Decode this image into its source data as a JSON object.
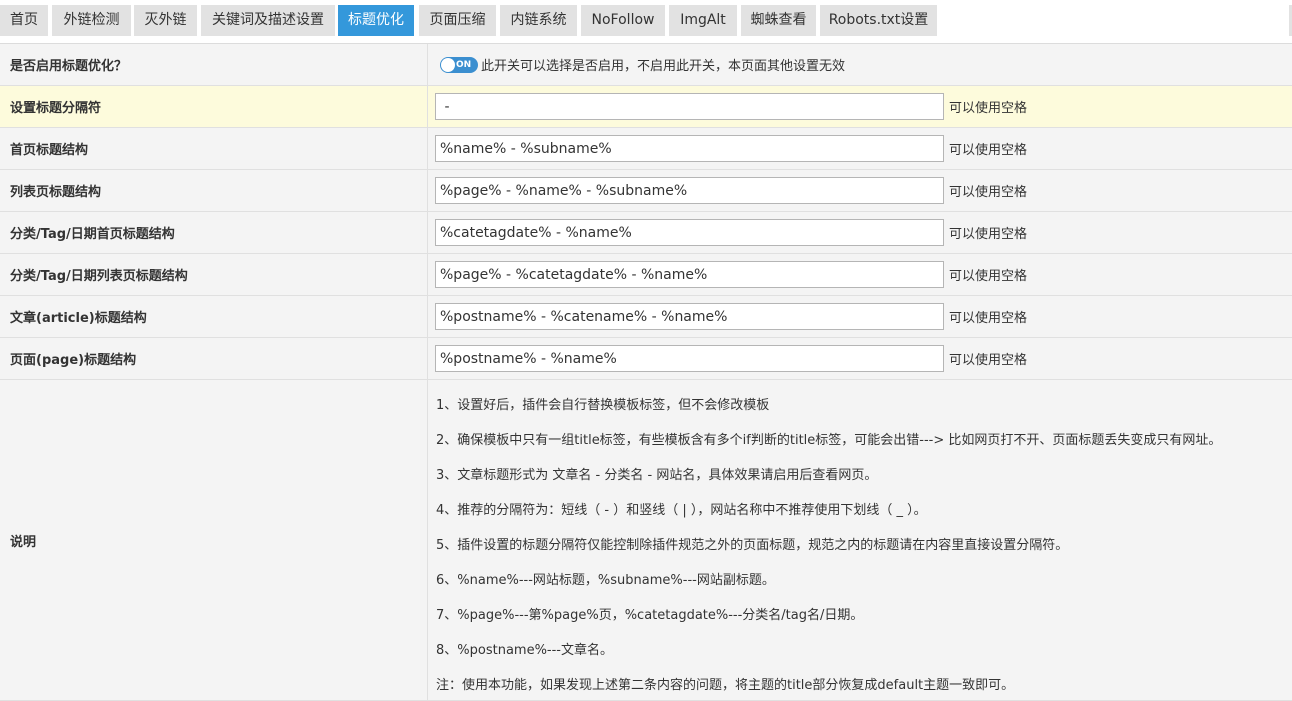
{
  "tabs": [
    {
      "label": "首页"
    },
    {
      "label": "外链检测"
    },
    {
      "label": "灭外链"
    },
    {
      "label": "关键词及描述设置"
    },
    {
      "label": "标题优化"
    },
    {
      "label": "页面压缩"
    },
    {
      "label": "内链系统"
    },
    {
      "label": "NoFollow"
    },
    {
      "label": "ImgAlt"
    },
    {
      "label": "蜘蛛查看"
    },
    {
      "label": "Robots.txt设置"
    }
  ],
  "active_tab": "标题优化",
  "enable_row": {
    "label": "是否启用标题优化？",
    "toggle_state": "ON",
    "description": "此开关可以选择是否启用，不启用此开关，本页面其他设置无效"
  },
  "fields": [
    {
      "label": "设置标题分隔符",
      "value": " - ",
      "hint": "可以使用空格"
    },
    {
      "label": "首页标题结构",
      "value": "%name% - %subname%",
      "hint": "可以使用空格"
    },
    {
      "label": "列表页标题结构",
      "value": "%page% - %name% - %subname%",
      "hint": "可以使用空格"
    },
    {
      "label": "分类/Tag/日期首页标题结构",
      "value": "%catetagdate% - %name%",
      "hint": "可以使用空格"
    },
    {
      "label": "分类/Tag/日期列表页标题结构",
      "value": "%page% - %catetagdate% - %name%",
      "hint": "可以使用空格"
    },
    {
      "label": "文章(article)标题结构",
      "value": "%postname% - %catename% - %name%",
      "hint": "可以使用空格"
    },
    {
      "label": "页面(page)标题结构",
      "value": "%postname% - %name%",
      "hint": "可以使用空格"
    }
  ],
  "notes": {
    "label": "说明",
    "lines": [
      "1、设置好后，插件会自行替换模板标签，但不会修改模板",
      "2、确保模板中只有一组title标签，有些模板含有多个if判断的title标签，可能会出错---> 比如网页打不开、页面标题丢失变成只有网址。",
      "3、文章标题形式为 文章名 - 分类名 - 网站名，具体效果请启用后查看网页。",
      "4、推荐的分隔符为：短线（ - ）和竖线（ | ），网站名称中不推荐使用下划线（ _ ）。",
      "5、插件设置的标题分隔符仅能控制除插件规范之外的页面标题，规范之内的标题请在内容里直接设置分隔符。",
      "6、%name%---网站标题，%subname%---网站副标题。",
      "7、%page%---第%page%页，%catetagdate%---分类名/tag名/日期。",
      "8、%postname%---文章名。",
      "注：使用本功能，如果发现上述第二条内容的问题，将主题的title部分恢复成default主题一致即可。"
    ]
  },
  "colors": {
    "tab_bg": "#e2e2e2",
    "tab_active_bg": "#3498db",
    "row_bg": "#f4f4f4",
    "row_highlight_bg": "#fdfbdc",
    "toggle_on": "#3b8fd0"
  },
  "icons": {
    "toggle": "toggle-switch-icon"
  }
}
